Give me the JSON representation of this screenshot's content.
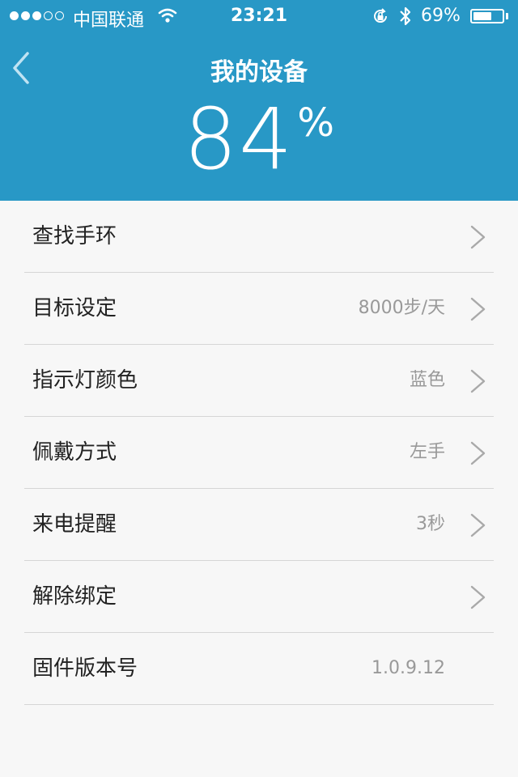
{
  "status_bar": {
    "carrier": "中国联通",
    "time": "23:21",
    "battery_percent": "69%",
    "battery_level": 0.69,
    "signal_filled": 3,
    "signal_total": 5
  },
  "nav": {
    "title": "我的设备",
    "back_icon": "chevron-left-icon"
  },
  "battery_display": {
    "value": "84",
    "unit": "%"
  },
  "settings": {
    "items": [
      {
        "label": "查找手环",
        "value": ""
      },
      {
        "label": "目标设定",
        "value": "8000步/天"
      },
      {
        "label": "指示灯颜色",
        "value": "蓝色"
      },
      {
        "label": "佩戴方式",
        "value": "左手"
      },
      {
        "label": "来电提醒",
        "value": "3秒"
      },
      {
        "label": "解除绑定",
        "value": ""
      },
      {
        "label": "固件版本号",
        "value": "1.0.9.12"
      }
    ]
  },
  "colors": {
    "header_bg": "#2898c6",
    "list_bg": "#f7f7f7",
    "label_text": "#222222",
    "value_text": "#999999",
    "divider": "#d6d6d6"
  }
}
